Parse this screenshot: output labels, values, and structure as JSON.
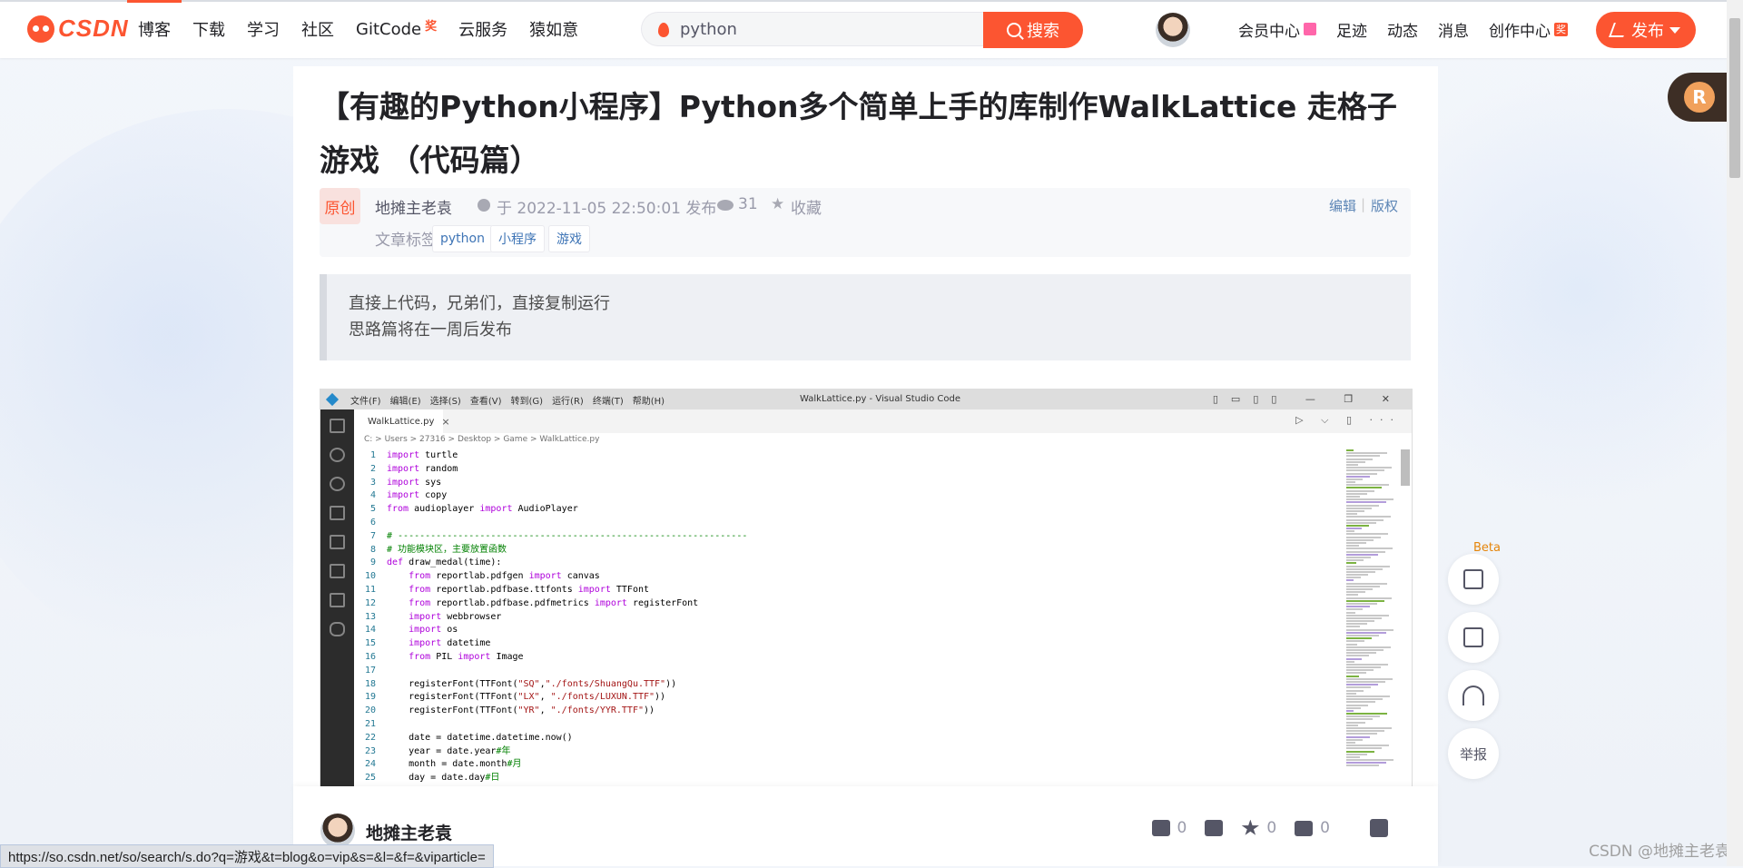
{
  "nav": {
    "logo_text": "CSDN",
    "items": [
      {
        "label": "博客"
      },
      {
        "label": "下载"
      },
      {
        "label": "学习"
      },
      {
        "label": "社区"
      },
      {
        "label": "GitCode",
        "badge": "奖"
      },
      {
        "label": "云服务"
      },
      {
        "label": "猿如意"
      }
    ],
    "search": {
      "value": "python",
      "button": "搜索"
    },
    "right_links": [
      "会员中心",
      "足迹",
      "动态",
      "消息",
      "创作中心"
    ],
    "creator_badge": "奖",
    "publish": "发布",
    "accent": "#fc5531"
  },
  "article": {
    "title": "【有趣的Python小程序】Python多个简单上手的库制作WalkLattice 走格子游戏 （代码篇）",
    "badge": "原创",
    "author": "地摊主老袁",
    "time": "于 2022-11-05 22:50:01 发布",
    "views": "31",
    "collect": "收藏",
    "edit": "编辑",
    "separator": "|",
    "copyright": "版权",
    "tag_label": "文章标签:",
    "tags": [
      "python",
      "小程序",
      "游戏"
    ],
    "quote_lines": [
      "直接上代码，兄弟们，直接复制运行",
      "思路篇将在一周后发布"
    ]
  },
  "vscode": {
    "menus": [
      "文件(F)",
      "编辑(E)",
      "选择(S)",
      "查看(V)",
      "转到(G)",
      "运行(R)",
      "终端(T)",
      "帮助(H)"
    ],
    "window_title": "WalkLattice.py - Visual Studio Code",
    "window_controls": "▯▭▯▯ — ❐ ✕",
    "tab_name": "WalkLattice.py",
    "tab_close": "×",
    "tab_actions": "▷ ⌵ ▯ ···",
    "breadcrumb": "C: > Users > 27316 > Desktop > Game > WalkLattice.py",
    "lines": [
      {
        "n": "1",
        "t": "import turtle"
      },
      {
        "n": "2",
        "t": "import random"
      },
      {
        "n": "3",
        "t": "import sys"
      },
      {
        "n": "4",
        "t": "import copy"
      },
      {
        "n": "5",
        "t": "from audioplayer import AudioPlayer"
      },
      {
        "n": "6",
        "t": ""
      },
      {
        "n": "7",
        "t": "# ----------------------------------------------------------------"
      },
      {
        "n": "8",
        "t": "# 功能模块区，主要放置函数"
      },
      {
        "n": "9",
        "t": "def draw_medal(time):"
      },
      {
        "n": "10",
        "t": "    from reportlab.pdfgen import canvas"
      },
      {
        "n": "11",
        "t": "    from reportlab.pdfbase.ttfonts import TTFont"
      },
      {
        "n": "12",
        "t": "    from reportlab.pdfbase.pdfmetrics import registerFont"
      },
      {
        "n": "13",
        "t": "    import webbrowser"
      },
      {
        "n": "14",
        "t": "    import os"
      },
      {
        "n": "15",
        "t": "    import datetime"
      },
      {
        "n": "16",
        "t": "    from PIL import Image"
      },
      {
        "n": "17",
        "t": ""
      },
      {
        "n": "18",
        "t": "    registerFont(TTFont(\"SQ\",\"./fonts/ShuangQu.TTF\"))"
      },
      {
        "n": "19",
        "t": "    registerFont(TTFont(\"LX\", \"./fonts/LUXUN.TTF\"))"
      },
      {
        "n": "20",
        "t": "    registerFont(TTFont(\"YR\", \"./fonts/YYR.TTF\"))"
      },
      {
        "n": "21",
        "t": ""
      },
      {
        "n": "22",
        "t": "    date = datetime.datetime.now()"
      },
      {
        "n": "23",
        "t": "    year = date.year#年"
      },
      {
        "n": "24",
        "t": "    month = date.month#月"
      },
      {
        "n": "25",
        "t": "    day = date.day#日"
      }
    ]
  },
  "author_bar": {
    "name": "地摊主老袁",
    "likes": "0",
    "collects": "0",
    "comments": "0"
  },
  "float_badge": "R",
  "side_tools": {
    "beta": "Beta",
    "report": "举报"
  },
  "status_url": "https://so.csdn.net/so/search/s.do?q=游戏&t=blog&o=vip&s=&l=&f=&viparticle=",
  "watermark": "CSDN @地摊主老袁"
}
